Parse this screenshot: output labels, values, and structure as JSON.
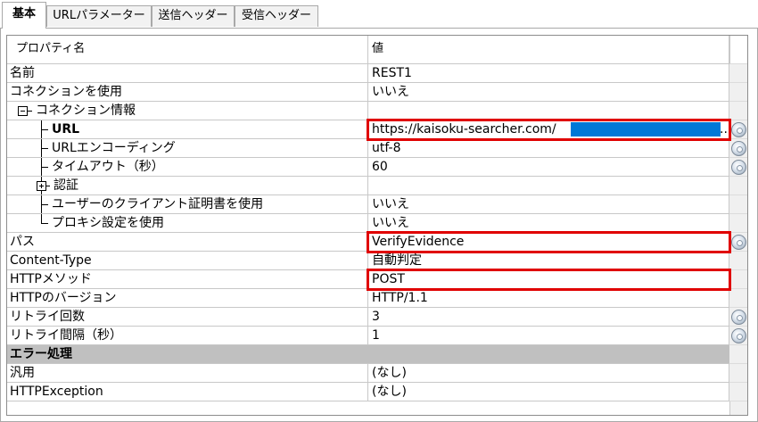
{
  "tabs": [
    {
      "label": "基本",
      "active": true
    },
    {
      "label": "URLパラメーター",
      "active": false
    },
    {
      "label": "送信ヘッダー",
      "active": false
    },
    {
      "label": "受信ヘッダー",
      "active": false
    }
  ],
  "header": {
    "property": "プロパティ名",
    "value": "値"
  },
  "rows": [
    {
      "name": "名前",
      "value": "REST1"
    },
    {
      "name": "コネクションを使用",
      "value": "いいえ"
    },
    {
      "name": "コネクション情報",
      "value": ""
    },
    {
      "name": "URL",
      "value": "https://kaisoku-searcher.com/",
      "ellipsis": "..."
    },
    {
      "name": "URLエンコーディング",
      "value": "utf-8"
    },
    {
      "name": "タイムアウト（秒）",
      "value": "60"
    },
    {
      "name": "認証",
      "value": ""
    },
    {
      "name": "ユーザーのクライアント証明書を使用",
      "value": "いいえ"
    },
    {
      "name": "プロキシ設定を使用",
      "value": "いいえ"
    },
    {
      "name": "パス",
      "value": "VerifyEvidence"
    },
    {
      "name": "Content-Type",
      "value": "自動判定"
    },
    {
      "name": "HTTPメソッド",
      "value": "POST"
    },
    {
      "name": "HTTPのバージョン",
      "value": "HTTP/1.1"
    },
    {
      "name": "リトライ回数",
      "value": "3"
    },
    {
      "name": "リトライ間隔（秒）",
      "value": "1"
    },
    {
      "name": "エラー処理",
      "value": ""
    },
    {
      "name": "汎用",
      "value": "(なし)"
    },
    {
      "name": "HTTPException",
      "value": "(なし)"
    }
  ],
  "colors": {
    "highlight_border": "#e00000",
    "masked_fill": "#0078d7",
    "section_bg": "#c0c0c0"
  }
}
